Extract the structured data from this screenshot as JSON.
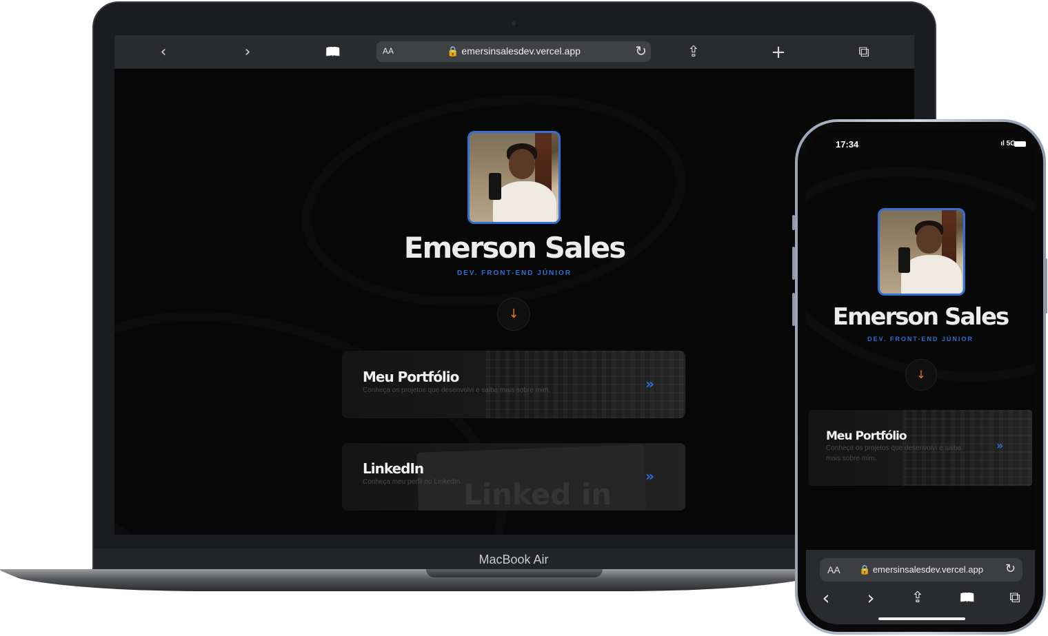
{
  "laptop": {
    "device_label": "MacBook Air",
    "browser": {
      "back_icon": "‹",
      "forward_icon": "›",
      "bookmarks_icon": "📖",
      "text_size_label": "AA",
      "url": "🔒 emersinsalesdev.vercel.app",
      "reload_icon": "↻",
      "share_icon": "⇪",
      "new_tab_icon": "+",
      "tabs_icon": "⧉"
    },
    "page": {
      "name": "Emerson Sales",
      "role": "DEV. FRONT-END JÚNIOR",
      "scroll_icon": "↓",
      "cards": [
        {
          "title": "Meu Portfólio",
          "description": "Conheça os projetos que desenvolvi e saiba mais sobre mim.",
          "chevron": "»"
        },
        {
          "title": "LinkedIn",
          "description": "Conheça meu perfil no LinkedIn.",
          "chevron": "»",
          "watermark": "Linked in"
        }
      ]
    }
  },
  "phone": {
    "status": {
      "time": "17:34",
      "signal": "ıl 5G"
    },
    "page": {
      "name": "Emerson Sales",
      "role": "DEV. FRONT-END JÚNIOR",
      "scroll_icon": "↓",
      "cards": [
        {
          "title": "Meu Portfólio",
          "description": "Conheça os projetos que desenvolvi e saiba mais sobre mim.",
          "chevron": "»"
        }
      ]
    },
    "toolbar": {
      "text_size_label": "AA",
      "url": "🔒 emersinsalesdev.vercel.app",
      "reload_icon": "↻",
      "back_icon": "‹",
      "forward_icon": "›",
      "share_icon": "⇪",
      "bookmarks_icon": "📖",
      "tabs_icon": "⧉"
    }
  },
  "colors": {
    "accent_blue": "#2f6fd6",
    "accent_orange": "#e07a22",
    "background": "#070707"
  }
}
